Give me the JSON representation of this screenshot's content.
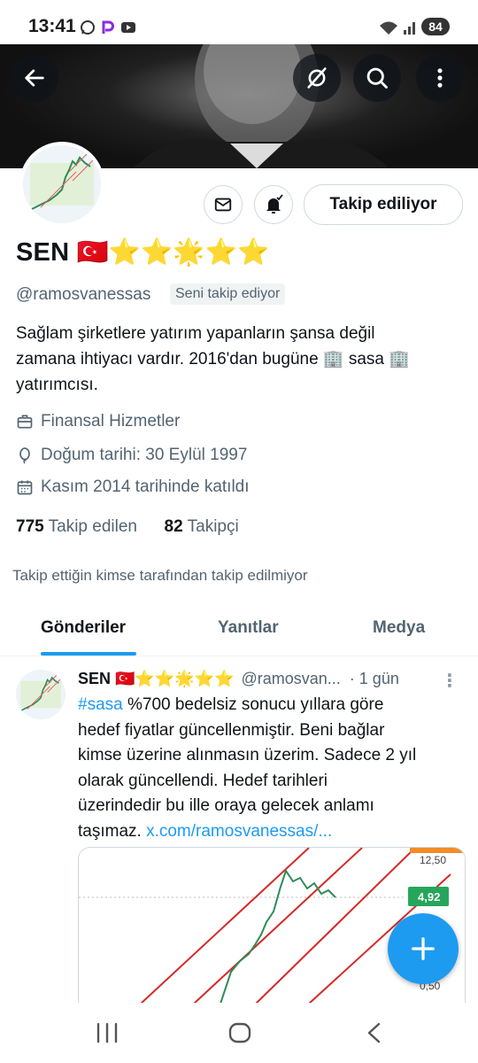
{
  "status_bar": {
    "time": "13:41",
    "battery": "84",
    "icons": [
      "whatsapp-icon",
      "p-app-icon",
      "youtube-icon",
      "wifi-icon",
      "signal-icon"
    ]
  },
  "banner": {
    "buttons": [
      "back-arrow-icon",
      "grok-icon",
      "search-icon",
      "more-vertical-icon"
    ]
  },
  "profile": {
    "follow_button_label": "Takip ediliyor",
    "display_name": "SEN 🇹🇷⭐⭐🌟⭐⭐",
    "handle": "@ramosvanessas",
    "follows_you_badge": "Seni takip ediyor",
    "bio_line1": "Sağlam şirketlere yatırım yapanların şansa değil",
    "bio_line2": "zamana ihtiyacı vardır.  2016'dan bugüne 🏢 sasa 🏢",
    "bio_line3": "yatırımcısı.",
    "category": "Finansal Hizmetler",
    "birthday": "Doğum tarihi: 30 Eylül 1997",
    "joined": "Kasım 2014 tarihinde katıldı",
    "following_count": "775",
    "following_label": "Takip edilen",
    "followers_count": "82",
    "followers_label": "Takipçi",
    "mutuals_note": "Takip ettiğin kimse tarafından takip edilmiyor"
  },
  "tabs": [
    {
      "label": "Gönderiler",
      "active": true
    },
    {
      "label": "Yanıtlar",
      "active": false
    },
    {
      "label": "Medya",
      "active": false
    }
  ],
  "tweet": {
    "name": "SEN 🇹🇷⭐⭐🌟⭐⭐",
    "handle": "@ramosvan...",
    "time": "· 1 gün",
    "hashtag": "#sasa",
    "text_line1": " %700 bedelsiz sonucu yıllara göre",
    "text_line2": "hedef fiyatlar güncellenmiştir. Beni bağlar",
    "text_line3": "kimse üzerine alınmasın üzerim. Sadece 2 yıl",
    "text_line4": "olarak güncellendi. Hedef tarihleri",
    "text_line5": "üzerindedir bu ille oraya gelecek anlamı",
    "text_line6": "taşımaz. ",
    "link": "x.com/ramosvanessas/...",
    "media": {
      "price_top": "12,50",
      "price_current": "4,92",
      "price_bottom": "0,50",
      "price_current_color": "#26a65b"
    }
  },
  "accent_color": "#1d9bf0",
  "nav_bar": [
    "recent-apps-icon",
    "home-icon",
    "back-icon"
  ]
}
